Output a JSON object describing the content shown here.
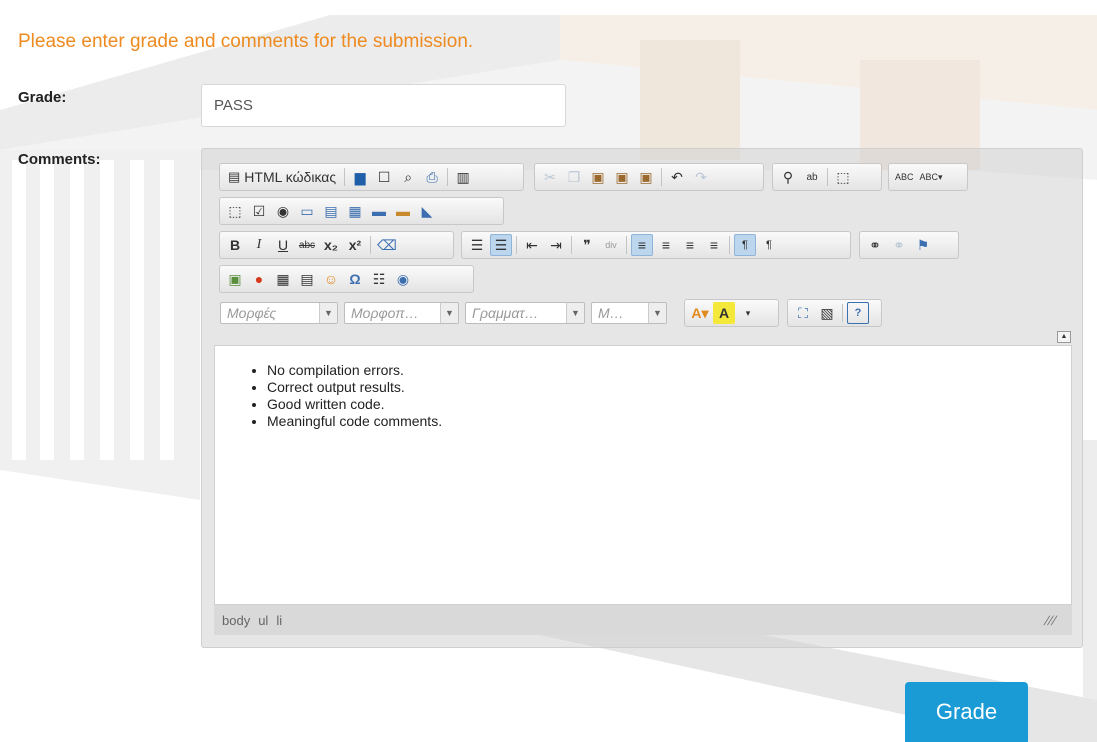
{
  "page": {
    "title": "Please enter grade and comments for the submission.",
    "grade_label": "Grade:",
    "comments_label": "Comments:"
  },
  "grade_field": {
    "value": "PASS"
  },
  "editor": {
    "source_button": "HTML κώδικας",
    "combos": {
      "styles": "Μορφές",
      "format": "Μορφοπ…",
      "font": "Γραμματ…",
      "size": "Μ…"
    },
    "content_items": [
      "No compilation errors.",
      "Correct output results.",
      "Good written code.",
      "Meaningful code comments."
    ],
    "path": [
      "body",
      "ul",
      "li"
    ]
  },
  "submit": {
    "label": "Grade"
  },
  "colors": {
    "title": "#ee8a1f",
    "button": "#1a9bd5"
  }
}
